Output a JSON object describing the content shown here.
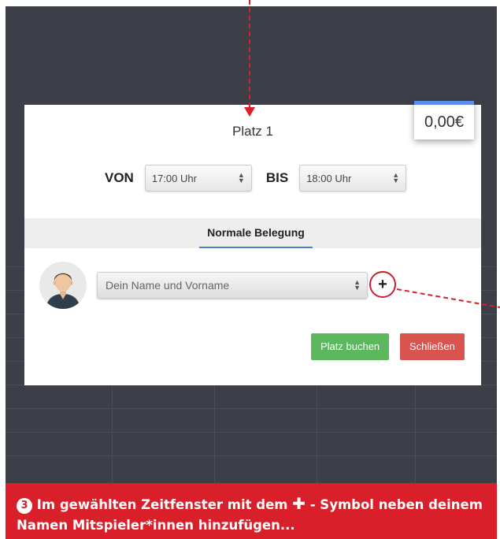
{
  "modal": {
    "price": "0,00€",
    "title": "Platz 1",
    "from_label": "VON",
    "from_value": "17:00 Uhr",
    "to_label": "BIS",
    "to_value": "18:00 Uhr",
    "tab_label": "Normale Belegung",
    "name_placeholder": "Dein Name und Vorname",
    "add_symbol": "+",
    "book_label": "Platz buchen",
    "close_label": "Schließen"
  },
  "caption": {
    "step": "3",
    "text_before": "Im gewählten Zeitfenster mit dem",
    "symbol": "✚",
    "text_after": "- Symbol neben deinem Namen Mitspieler*innen hinzufügen..."
  },
  "colors": {
    "annotation_red": "#d91f2a",
    "accent_blue": "#5b8def",
    "book_green": "#5cb85c",
    "close_red": "#d9534f",
    "backdrop": "#3c3f47"
  },
  "icons": [
    "user-avatar-icon",
    "plus-icon",
    "select-arrows-icon"
  ]
}
